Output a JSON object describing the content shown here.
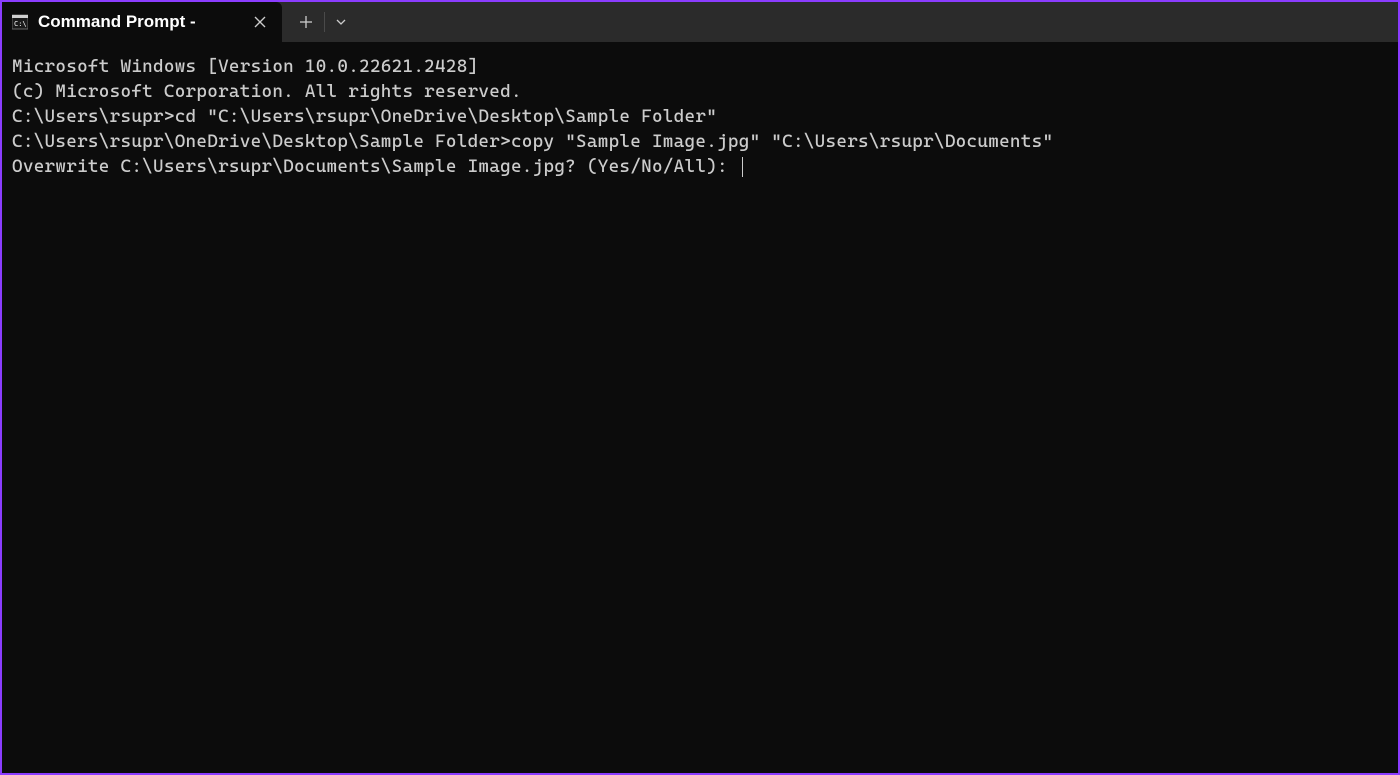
{
  "titlebar": {
    "tab_title": "Command Prompt -"
  },
  "terminal": {
    "line1": "Microsoft Windows [Version 10.0.22621.2428]",
    "line2": "(c) Microsoft Corporation. All rights reserved.",
    "line3": "",
    "line4": "C:\\Users\\rsupr>cd \"C:\\Users\\rsupr\\OneDrive\\Desktop\\Sample Folder\"",
    "line5": "",
    "line6": "C:\\Users\\rsupr\\OneDrive\\Desktop\\Sample Folder>copy \"Sample Image.jpg\" \"C:\\Users\\rsupr\\Documents\"",
    "line7": "Overwrite C:\\Users\\rsupr\\Documents\\Sample Image.jpg? (Yes/No/All): "
  }
}
